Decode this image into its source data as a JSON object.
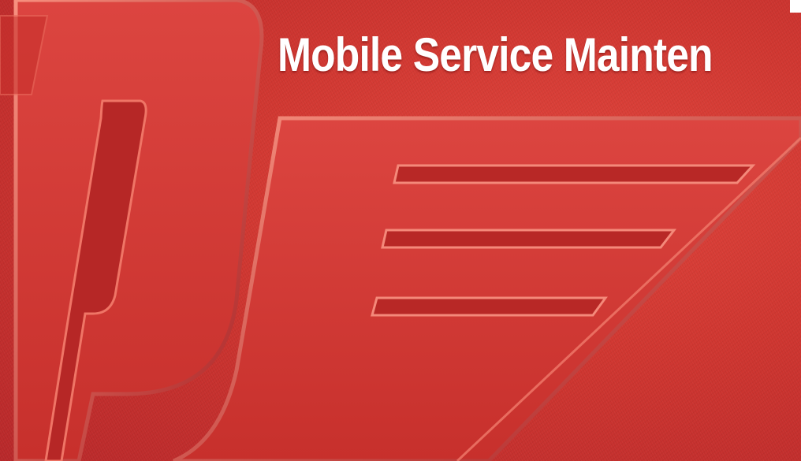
{
  "banner": {
    "headline": "Mobile Service Mainten",
    "logo_icon": "pj-winged-logo-icon",
    "colors": {
      "background": "#c8302c",
      "logo_face": "#d43a34",
      "highlight": "#f07a6c",
      "headline_text": "#ffffff"
    }
  }
}
